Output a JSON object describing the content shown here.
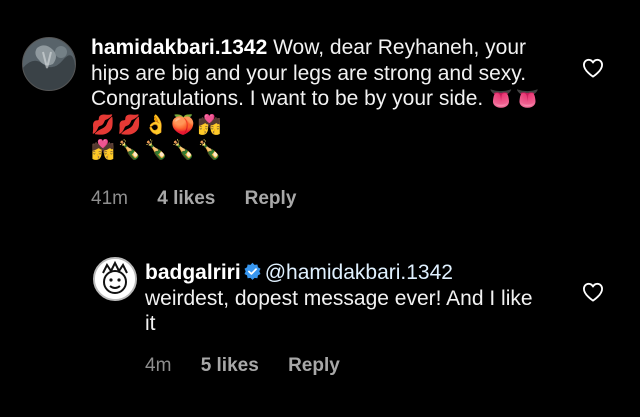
{
  "comments": [
    {
      "username": "hamidakbari.1342",
      "text": "Wow, dear Reyhaneh, your hips are big and your legs are strong and sexy. Congratulations. I want to be by your side.",
      "emojis_line1": [
        "👅",
        "👅",
        "💋",
        "💋",
        "👌",
        "🍑",
        "💏"
      ],
      "emojis_line2": [
        "💏",
        "🍾",
        "🍾",
        "🍾",
        "🍾"
      ],
      "time": "41m",
      "likes": "4 likes",
      "reply_label": "Reply",
      "avatar_icon": "landscape-avatar-icon"
    },
    {
      "username": "badgalriri",
      "verified": true,
      "mention": "@hamidakbari.1342",
      "text": "weirdest, dopest message ever! And I like it",
      "time": "4m",
      "likes": "5 likes",
      "reply_label": "Reply",
      "avatar_icon": "cartoon-face-avatar-icon"
    }
  ],
  "colors": {
    "background": "#000000",
    "text": "#f2f2f2",
    "meta": "#8e8e8e",
    "verified": "#3897f0"
  },
  "icons": {
    "like": "heart-outline-icon",
    "verified": "verified-badge-icon"
  }
}
